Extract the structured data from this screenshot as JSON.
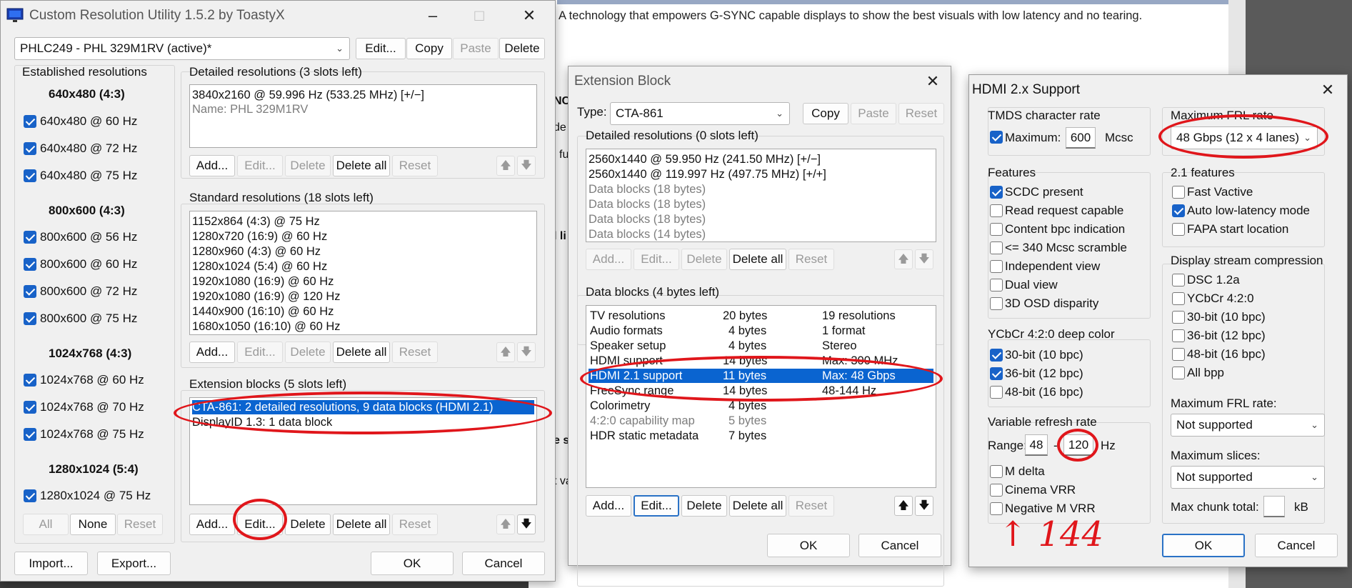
{
  "background": {
    "banner_text": "A technology that empowers G-SYNC capable displays to show the best visuals with low latency and no tearing.",
    "fragments": [
      "NC",
      "de",
      "l fu",
      "l li",
      "e s",
      "t va"
    ]
  },
  "main": {
    "title": "Custom Resolution Utility 1.5.2 by ToastyX",
    "monitor": "PHLC249 - PHL 329M1RV (active)*",
    "edit": "Edit...",
    "copy": "Copy",
    "paste": "Paste",
    "delete": "Delete",
    "established": {
      "label": "Established resolutions",
      "sections": [
        {
          "header": "640x480 (4:3)",
          "items": [
            "640x480 @ 60 Hz",
            "640x480 @ 72 Hz",
            "640x480 @ 75 Hz"
          ]
        },
        {
          "header": "800x600 (4:3)",
          "items": [
            "800x600 @ 56 Hz",
            "800x600 @ 60 Hz",
            "800x600 @ 72 Hz",
            "800x600 @ 75 Hz"
          ]
        },
        {
          "header": "1024x768 (4:3)",
          "items": [
            "1024x768 @ 60 Hz",
            "1024x768 @ 70 Hz",
            "1024x768 @ 75 Hz"
          ]
        },
        {
          "header": "1280x1024 (5:4)",
          "items": [
            "1280x1024 @ 75 Hz"
          ]
        }
      ],
      "all": "All",
      "none": "None",
      "reset": "Reset"
    },
    "detailed": {
      "label": "Detailed resolutions (3 slots left)",
      "items": [
        "3840x2160 @ 59.996 Hz (533.25 MHz) [+/−]",
        "Name: PHL 329M1RV"
      ]
    },
    "standard": {
      "label": "Standard resolutions (18 slots left)",
      "items": [
        "1152x864 (4:3) @ 75 Hz",
        "1280x720 (16:9) @ 60 Hz",
        "1280x960 (4:3) @ 60 Hz",
        "1280x1024 (5:4) @ 60 Hz",
        "1920x1080 (16:9) @ 60 Hz",
        "1920x1080 (16:9) @ 120 Hz",
        "1440x900 (16:10) @ 60 Hz",
        "1680x1050 (16:10) @ 60 Hz"
      ]
    },
    "extension": {
      "label": "Extension blocks (5 slots left)",
      "items": [
        "CTA-861: 2 detailed resolutions, 9 data blocks (HDMI 2.1)",
        "DisplayID 1.3: 1 data block"
      ]
    },
    "add": "Add...",
    "edit_btn": "Edit...",
    "delete_btn": "Delete",
    "delete_all": "Delete all",
    "reset": "Reset",
    "import": "Import...",
    "export": "Export...",
    "ok": "OK",
    "cancel": "Cancel"
  },
  "ext": {
    "title": "Extension Block",
    "type_label": "Type:",
    "type_value": "CTA-861",
    "copy": "Copy",
    "paste": "Paste",
    "reset": "Reset",
    "detailed_label": "Detailed resolutions (0 slots left)",
    "detailed_items": [
      "2560x1440 @ 59.950 Hz (241.50 MHz) [+/−]",
      "2560x1440 @ 119.997 Hz (497.75 MHz) [+/+]",
      "Data blocks (18 bytes)",
      "Data blocks (18 bytes)",
      "Data blocks (18 bytes)",
      "Data blocks (14 bytes)"
    ],
    "datablocks_label": "Data blocks (4 bytes left)",
    "rows": [
      [
        "TV resolutions",
        "20 bytes",
        "19 resolutions"
      ],
      [
        "Audio formats",
        "4 bytes",
        "1 format"
      ],
      [
        "Speaker setup",
        "4 bytes",
        "Stereo"
      ],
      [
        "HDMI support",
        "14 bytes",
        "Max: 300 MHz"
      ],
      [
        "HDMI 2.1 support",
        "11 bytes",
        "Max: 48 Gbps"
      ],
      [
        "FreeSync range",
        "14 bytes",
        "48-144 Hz"
      ],
      [
        "Colorimetry",
        "4 bytes",
        ""
      ],
      [
        "4:2:0 capability map",
        "5 bytes",
        ""
      ],
      [
        "HDR static metadata",
        "7 bytes",
        ""
      ]
    ],
    "add": "Add...",
    "edit": "Edit...",
    "delete": "Delete",
    "delete_all": "Delete all",
    "ok": "OK",
    "cancel": "Cancel"
  },
  "hdmi": {
    "title": "HDMI 2.x Support",
    "tmds_label": "TMDS character rate",
    "maximum": "Maximum:",
    "tmds_value": "600",
    "tmds_unit": "Mcsc",
    "features_label": "Features",
    "features": [
      "SCDC present",
      "Read request capable",
      "Content bpc indication",
      "<= 340 Mcsc scramble",
      "Independent view",
      "Dual view",
      "3D OSD disparity"
    ],
    "ycbcr_label": "YCbCr 4:2:0 deep color",
    "ycbcr": [
      "30-bit (10 bpc)",
      "36-bit (12 bpc)",
      "48-bit (16 bpc)"
    ],
    "vrr_label": "Variable refresh rate",
    "range_label": "Range:",
    "range_min": "48",
    "range_dash": "-",
    "range_max": "120",
    "range_unit": "Hz",
    "vrr_opts": [
      "M delta",
      "Cinema VRR",
      "Negative M VRR"
    ],
    "frl_label": "Maximum FRL rate",
    "frl_value": "48 Gbps (12 x 4 lanes)",
    "f21_label": "2.1 features",
    "f21": [
      "Fast Vactive",
      "Auto low-latency mode",
      "FAPA start location"
    ],
    "dsc_label": "Display stream compression",
    "dsc": [
      "DSC 1.2a",
      "YCbCr 4:2:0",
      "30-bit (10 bpc)",
      "36-bit (12 bpc)",
      "48-bit (16 bpc)",
      "All bpp"
    ],
    "dsc_frl_label": "Maximum FRL rate:",
    "dsc_frl_value": "Not supported",
    "slices_label": "Maximum slices:",
    "slices_value": "Not supported",
    "chunk_label": "Max chunk total:",
    "chunk_value": "",
    "chunk_unit": "kB",
    "ok": "OK",
    "cancel": "Cancel",
    "handwritten_note": "↑ 144"
  },
  "colors": {
    "accent": "#0a64d0",
    "annotation": "#e0161b",
    "checkbox": "#1862c8"
  }
}
